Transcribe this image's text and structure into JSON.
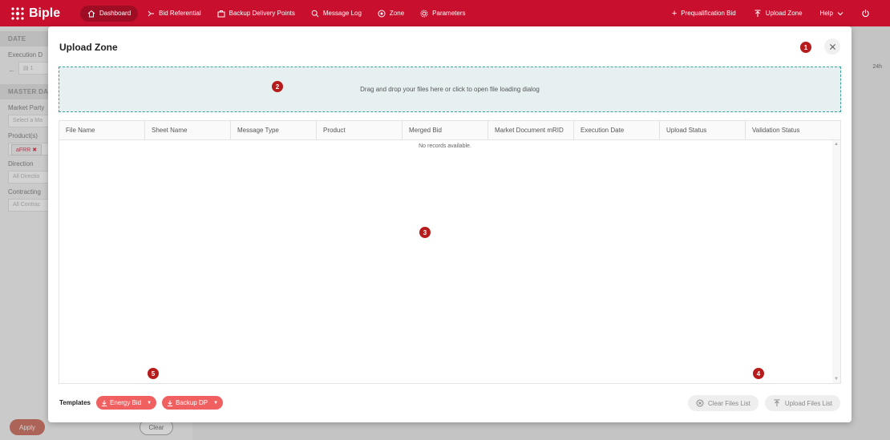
{
  "app": {
    "logo_text": "Biple"
  },
  "nav": {
    "items": [
      {
        "label": "Dashboard",
        "icon": "home-icon",
        "active": true
      },
      {
        "label": "Bid Referential",
        "icon": "bid-icon",
        "active": false
      },
      {
        "label": "Backup Delivery Points",
        "icon": "briefcase-icon",
        "active": false
      },
      {
        "label": "Message Log",
        "icon": "search-icon",
        "active": false
      },
      {
        "label": "Zone",
        "icon": "target-icon",
        "active": false
      },
      {
        "label": "Parameters",
        "icon": "gear-icon",
        "active": false
      }
    ],
    "prequalification_label": "Prequalification Bid",
    "upload_zone_label": "Upload Zone",
    "help_label": "Help"
  },
  "sidebar": {
    "date_header": "DATE",
    "execution_label": "Execution D",
    "date_value": "1",
    "master_header": "MASTER DA",
    "market_party_label": "Market Party",
    "market_party_placeholder": "Select a Ma",
    "products_label": "Product(s)",
    "product_chip": "aFRR",
    "direction_label": "Direction",
    "direction_value": "All Directio",
    "contracting_label": "Contracting",
    "contracting_value": "All Contrac",
    "apply_label": "Apply",
    "clear_label": "Clear"
  },
  "background": {
    "timeline_label": "24h"
  },
  "modal": {
    "title": "Upload Zone",
    "dropzone_text": "Drag and drop your files here or click to open file loading dialog",
    "columns": [
      "File Name",
      "Sheet Name",
      "Message Type",
      "Product",
      "Merged Bid",
      "Market Document mRID",
      "Execution Date",
      "Upload Status",
      "Validation Status"
    ],
    "no_records": "No records available.",
    "templates_label": "Templates",
    "templates": [
      {
        "label": "Energy Bid"
      },
      {
        "label": "Backup DP"
      }
    ],
    "clear_files_label": "Clear Files List",
    "upload_files_label": "Upload Files List",
    "badges": [
      "1",
      "2",
      "3",
      "4",
      "5"
    ]
  },
  "colors": {
    "brand": "#c8102e",
    "dropzone_border": "#3aa0a0",
    "template_button": "#f06060",
    "badge": "#b71c1c"
  }
}
